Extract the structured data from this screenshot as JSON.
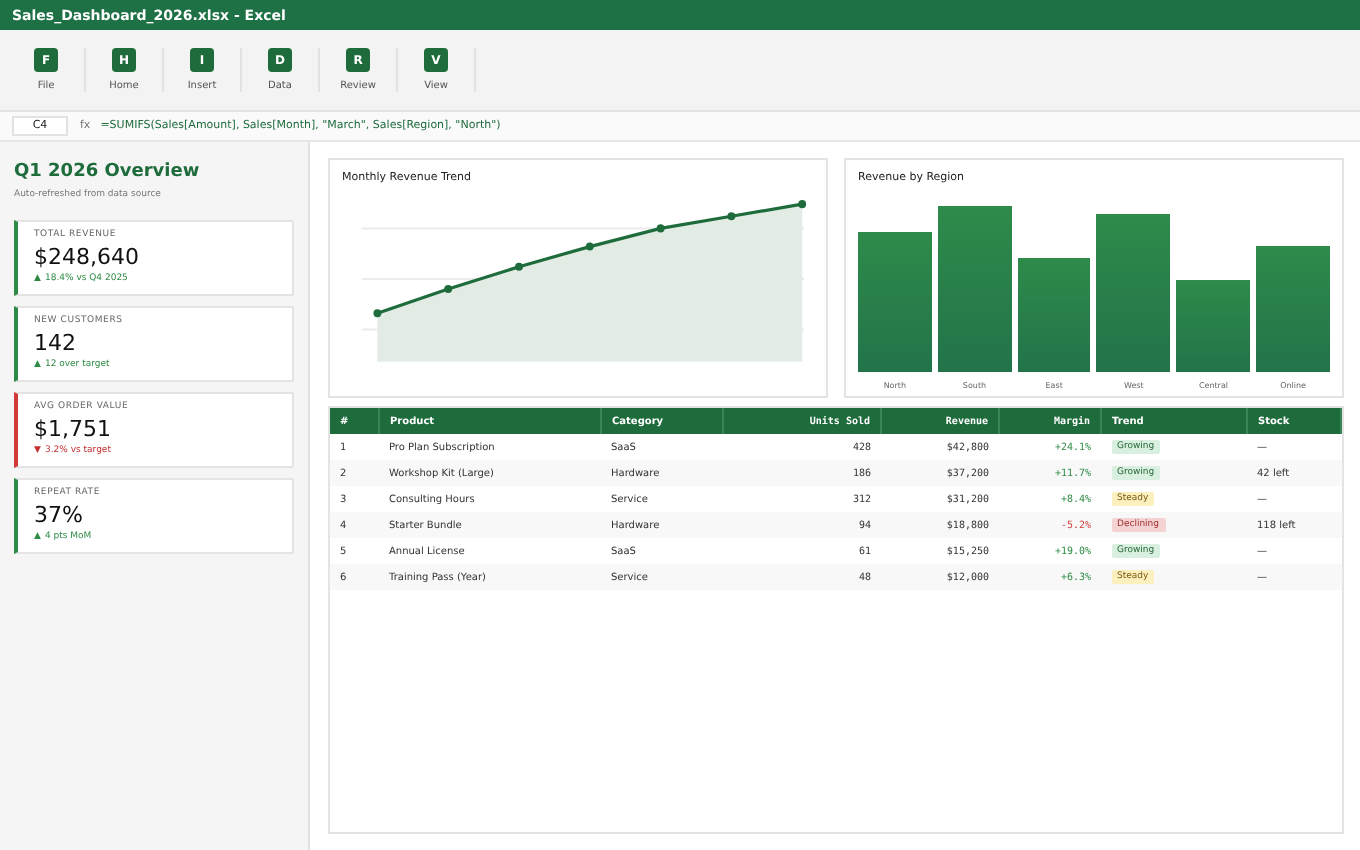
{
  "window": {
    "title": "Sales_Dashboard_2026.xlsx - Excel"
  },
  "ribbon": [
    {
      "key": "F",
      "label": "File"
    },
    {
      "key": "H",
      "label": "Home"
    },
    {
      "key": "I",
      "label": "Insert"
    },
    {
      "key": "D",
      "label": "Data"
    },
    {
      "key": "R",
      "label": "Review"
    },
    {
      "key": "V",
      "label": "View"
    }
  ],
  "formula_bar": {
    "cell": "C4",
    "fx": "fx",
    "formula": "=SUMIFS(Sales[Amount], Sales[Month], \"March\", Sales[Region], \"North\")"
  },
  "sidebar": {
    "title": "Q1 2026 Overview",
    "subtitle": "Auto-refreshed from data source",
    "kpis": [
      {
        "label": "TOTAL REVENUE",
        "value": "$248,640",
        "delta": "18.4% vs Q4 2025",
        "arrow": "▲",
        "negative": false
      },
      {
        "label": "NEW CUSTOMERS",
        "value": "142",
        "delta": "12 over target",
        "arrow": "▲",
        "negative": false
      },
      {
        "label": "AVG ORDER VALUE",
        "value": "$1,751",
        "delta": "3.2% vs target",
        "arrow": "▼",
        "negative": true
      },
      {
        "label": "REPEAT RATE",
        "value": "37%",
        "delta": "4 pts MoM",
        "arrow": "▲",
        "negative": false
      }
    ]
  },
  "line_chart": {
    "title": "Monthly Revenue Trend"
  },
  "bar_chart": {
    "title": "Revenue by Region",
    "categories": [
      "North",
      "South",
      "East",
      "West",
      "Central",
      "Online"
    ]
  },
  "table": {
    "columns": [
      "#",
      "Product",
      "Category",
      "Units Sold",
      "Revenue",
      "Margin",
      "Trend",
      "Stock"
    ],
    "rows": [
      {
        "cells": [
          "1",
          "Pro Plan Subscription",
          "SaaS",
          "428",
          "$42,800",
          "+24.1%",
          "Growing",
          "—"
        ],
        "kind": "growing",
        "negative": false
      },
      {
        "cells": [
          "2",
          "Workshop Kit (Large)",
          "Hardware",
          "186",
          "$37,200",
          "+11.7%",
          "Growing",
          "42 left"
        ],
        "kind": "growing",
        "negative": false
      },
      {
        "cells": [
          "3",
          "Consulting Hours",
          "Service",
          "312",
          "$31,200",
          "+8.4%",
          "Steady",
          "—"
        ],
        "kind": "steady",
        "negative": false
      },
      {
        "cells": [
          "4",
          "Starter Bundle",
          "Hardware",
          "94",
          "$18,800",
          "-5.2%",
          "Declining",
          "118 left"
        ],
        "kind": "declining",
        "negative": true
      },
      {
        "cells": [
          "5",
          "Annual License",
          "SaaS",
          "61",
          "$15,250",
          "+19.0%",
          "Growing",
          "—"
        ],
        "kind": "growing",
        "negative": false
      },
      {
        "cells": [
          "6",
          "Training Pass (Year)",
          "Service",
          "48",
          "$12,000",
          "+6.3%",
          "Steady",
          "—"
        ],
        "kind": "steady",
        "negative": false
      }
    ]
  }
}
